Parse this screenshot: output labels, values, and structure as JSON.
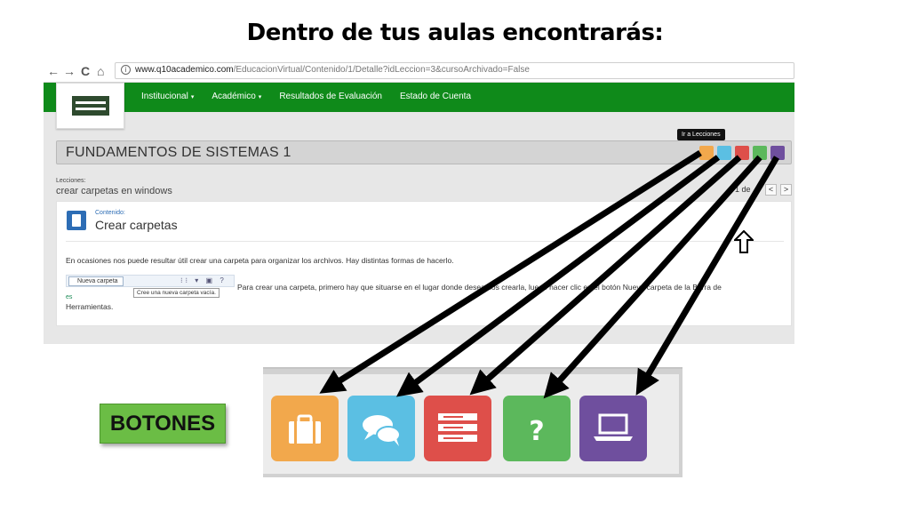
{
  "slide": {
    "title": "Dentro de tus aulas encontrarás:",
    "label": "BOTONES"
  },
  "browser": {
    "url_host": "www.q10academico.com",
    "url_path": "/EducacionVirtual/Contenido/1/Detalle?idLeccion=3&cursoArchivado=False",
    "nav_buttons": [
      "←",
      "→",
      "C",
      "⌂"
    ]
  },
  "nav": {
    "items": [
      {
        "label": "Institucional",
        "has_caret": true
      },
      {
        "label": "Académico",
        "has_caret": true
      },
      {
        "label": "Resultados de Evaluación",
        "has_caret": false
      },
      {
        "label": "Estado de Cuenta",
        "has_caret": false
      }
    ],
    "caret": "▾"
  },
  "course": {
    "title": "FUNDAMENTOS DE SISTEMAS 1",
    "tooltip": "Ir a Lecciones"
  },
  "lessons": {
    "label": "Lecciones:",
    "value": "crear carpetas en windows",
    "pager": "1 de",
    "prev": "<",
    "next": ">"
  },
  "content": {
    "label": "Contenido:",
    "title": "Crear carpetas",
    "para1": "En ocasiones nos puede resultar útil crear una carpeta para organizar los archivos. Hay distintas formas de hacerlo.",
    "toolbar_button": "Nueva carpeta",
    "toolbar_tip": "Cree una nueva carpeta vacía.",
    "para2": "Para crear una carpeta, primero hay que situarse en el lugar donde deseamos crearla, luego hacer clic en el botón Nueva carpeta de la Barra de",
    "es_fragment": "es",
    "para3": "Herramientas."
  },
  "buttons": [
    {
      "name": "lecciones-button",
      "icon": "briefcase-icon",
      "color": "#f2a84c"
    },
    {
      "name": "foro-button",
      "icon": "chat-bubbles-icon",
      "color": "#5bbfe3"
    },
    {
      "name": "contenidos-button",
      "icon": "list-icon",
      "color": "#de4f4a"
    },
    {
      "name": "evaluaciones-button",
      "icon": "question-icon",
      "color": "#5cb85c"
    },
    {
      "name": "aula-virtual-button",
      "icon": "laptop-icon",
      "color": "#6f4f9e"
    }
  ],
  "colors": {
    "nav_green": "#0f8a1a",
    "label_green": "#6bbd45"
  }
}
